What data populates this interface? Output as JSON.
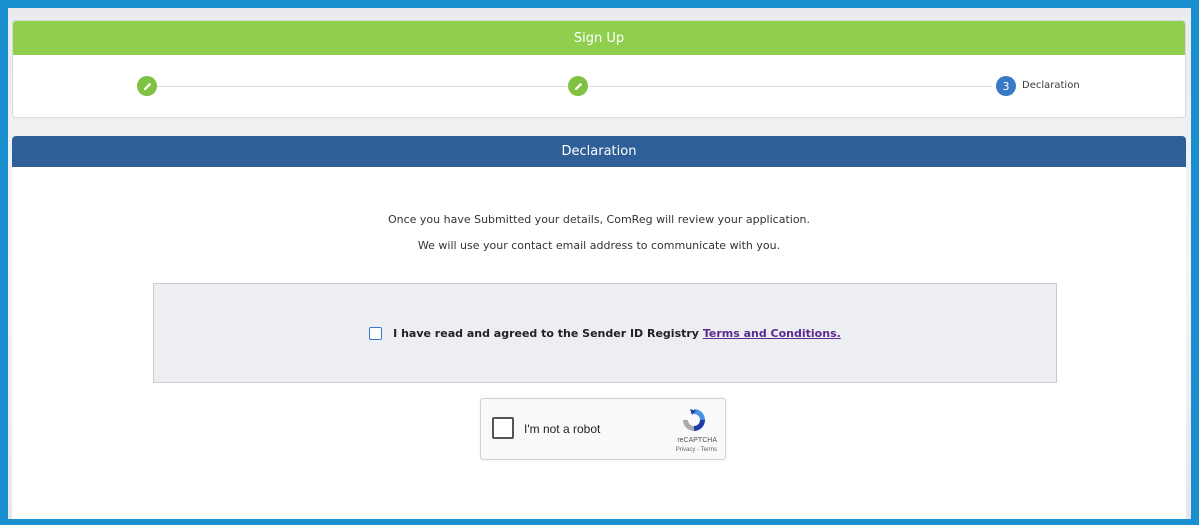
{
  "signup": {
    "title": "Sign Up",
    "steps": [
      {
        "state": "done",
        "icon": "pencil-icon"
      },
      {
        "state": "done",
        "icon": "pencil-icon"
      },
      {
        "state": "current",
        "number": "3",
        "label": "Declaration"
      }
    ]
  },
  "declaration": {
    "title": "Declaration",
    "line1": "Once you have Submitted your details, ComReg will review your application.",
    "line2": "We will use your contact email address to communicate with you.",
    "terms_text": "I have read and agreed to the Sender ID Registry",
    "terms_link": "Terms and Conditions."
  },
  "recaptcha": {
    "label": "I'm not a robot",
    "brand": "reCAPTCHA",
    "privacy": "Privacy",
    "separator": " - ",
    "terms": "Terms"
  },
  "colors": {
    "signup_header": "#8fcf4d",
    "declaration_header": "#2f5f98",
    "step_done": "#7fc241",
    "step_current": "#3a79c6",
    "link": "#5a2a91"
  }
}
